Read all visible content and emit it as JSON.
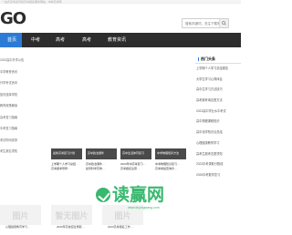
{
  "topbar": {
    "text": "一站式高考资讯和高考报名服务网站 · 中考高考网"
  },
  "header": {
    "logo_text": "GO",
    "search": {
      "placeholder": "搜索关键词，关注下载吧"
    }
  },
  "nav": {
    "items": [
      {
        "label": "首页"
      },
      {
        "label": "中考"
      },
      {
        "label": "高考"
      },
      {
        "label": "高考"
      },
      {
        "label": "教育资讯"
      }
    ]
  },
  "left_list": {
    "items": [
      "2023高中升学公告",
      "中学教育资讯",
      "升学考试资讯",
      "如何选择学校",
      "教育政策解读",
      "高考复习指南",
      "中考复习指南",
      "考试时间安排",
      "考生报名须知"
    ]
  },
  "cards": [
    {
      "thumb": "最新高考复习计划",
      "title": "上学期个人学习总结…"
    },
    {
      "thumb": "高中政治课件",
      "title": "高中政治课件…"
    },
    {
      "thumb": "高中生活体育复习",
      "title": "2023年中高考复习…"
    },
    {
      "thumb": "中学物理培养方法",
      "title": "中考物理知识复习…"
    }
  ],
  "card_subtitles": [
    "高考报考导师…",
    "如何科学高效…",
    "高考报名注意…",
    "高考成绩查询方…"
  ],
  "sidebar": {
    "heading": "热门头条",
    "items": [
      "上学期个人学习总结报告",
      "大学生学习心得体会",
      "高中生学习方法技巧",
      "高考报考填志愿方法",
      "2023高中学业水平考试",
      "高中物理课程知识",
      "高中化学知识点总结",
      "心理健康教育学习",
      "高考生报考志愿须知",
      "2023中考录取分数线",
      "2026中考数学复习"
    ]
  },
  "bottom": {
    "thumbs": [
      "图片",
      "暂无图片",
      "图片"
    ],
    "titles": [
      "心理健康教育学习…",
      "2026年高校招生录取…",
      "2023高考报名工作…"
    ]
  },
  "watermark": {
    "text": "读赢网",
    "subtext": "www.duyingwang.com"
  },
  "colors": {
    "nav_bg": "#2d2d2d",
    "nav_active": "#2b7bd6",
    "watermark_green": "#39b86f"
  }
}
